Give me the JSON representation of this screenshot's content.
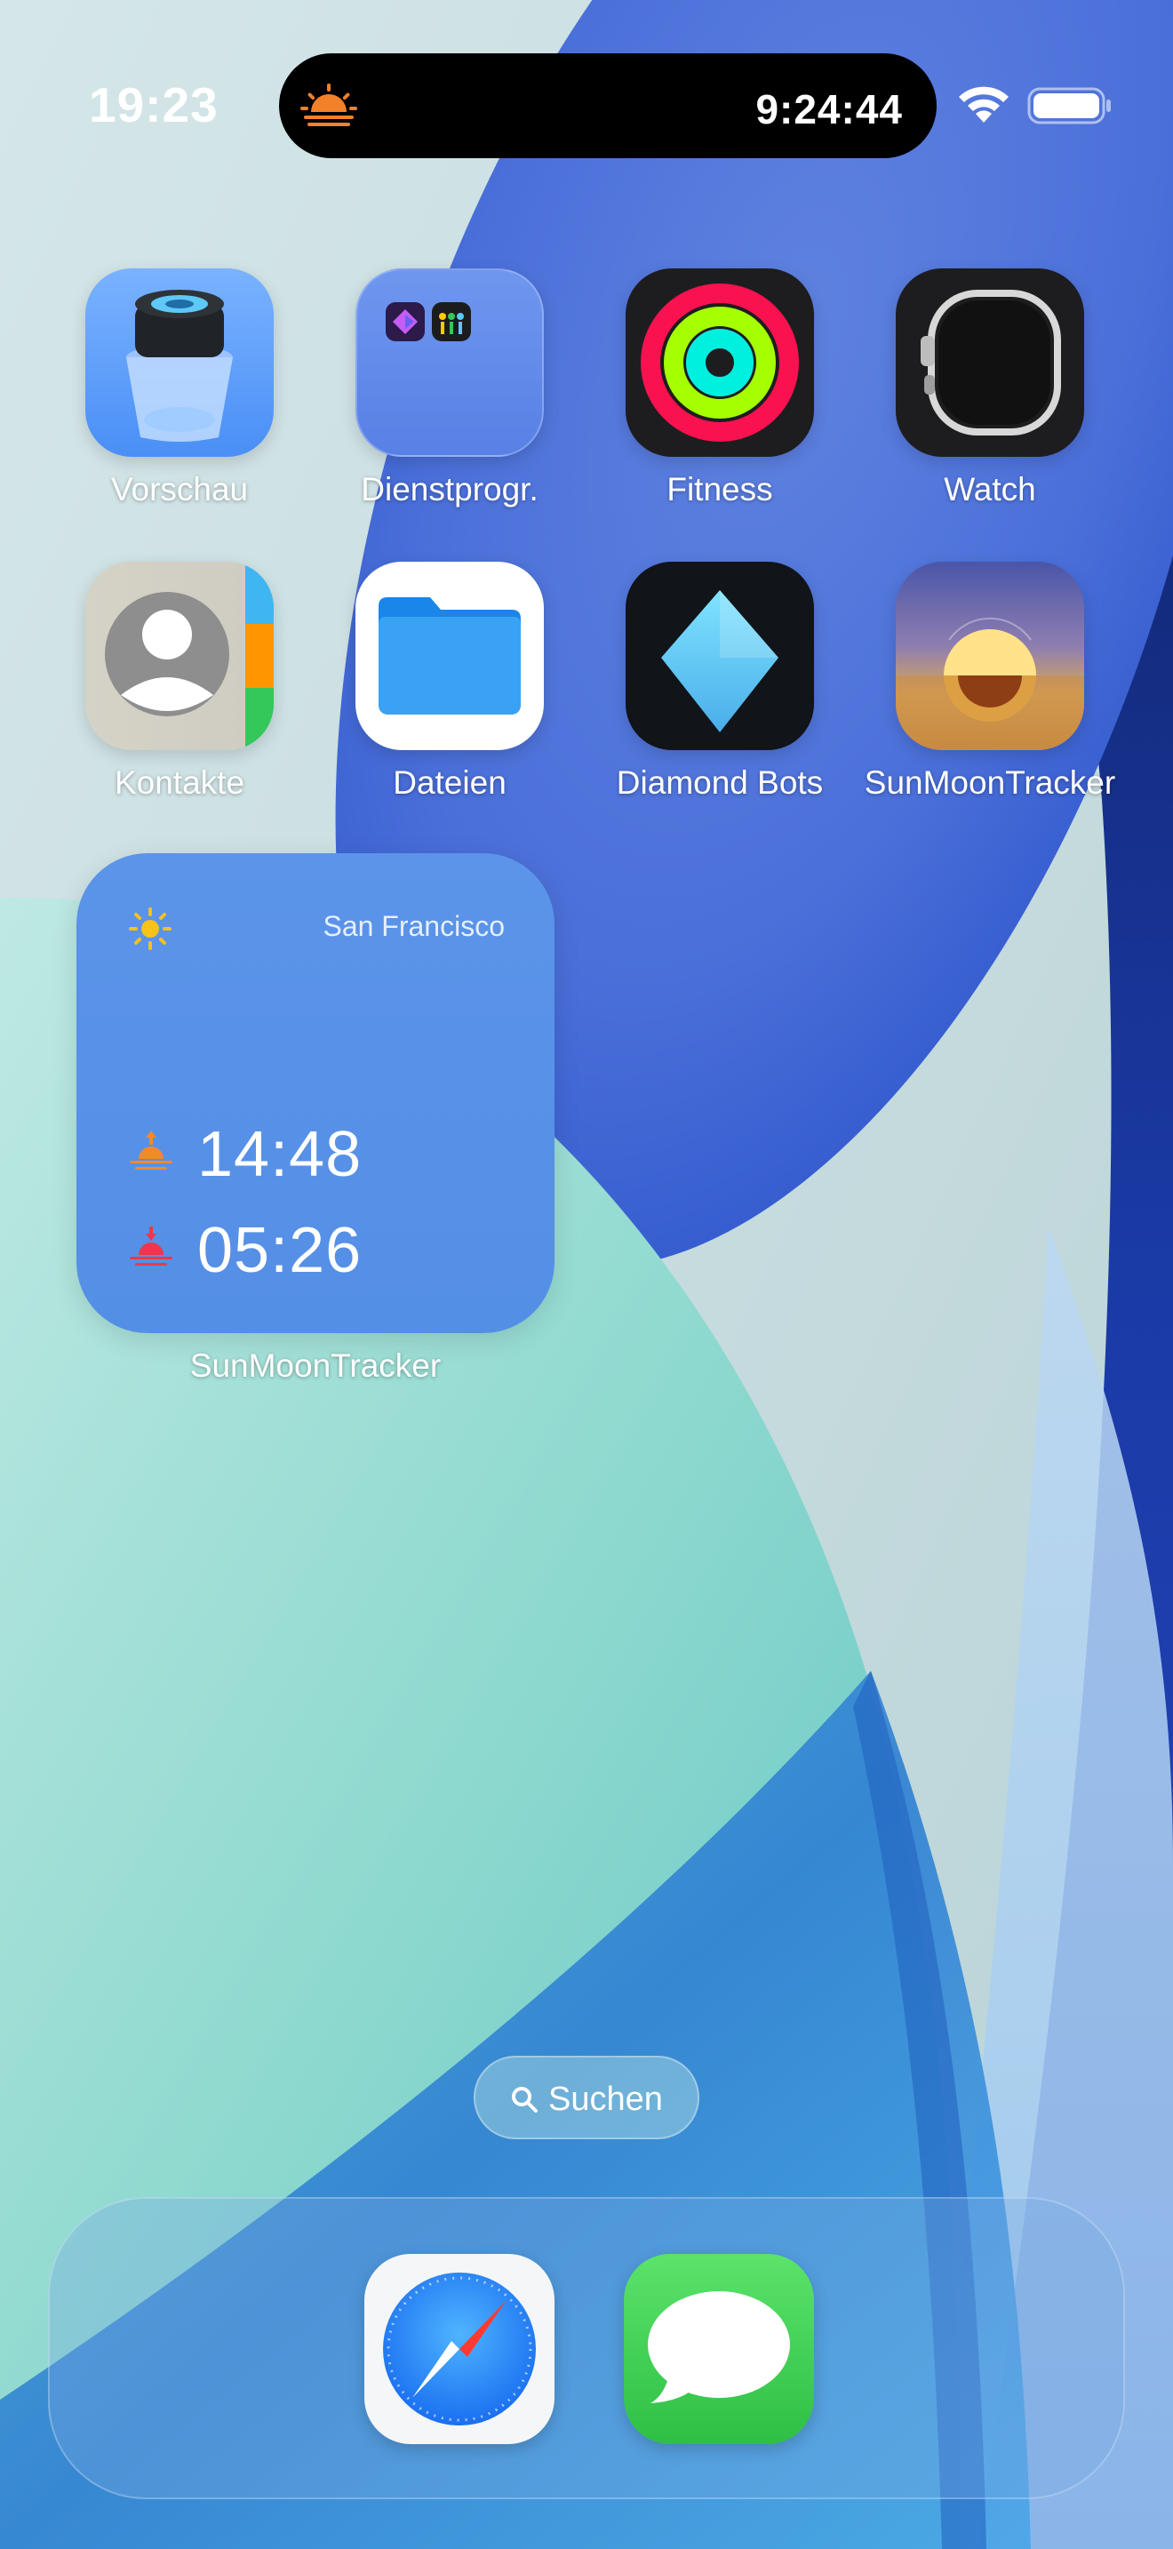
{
  "status_bar": {
    "time": "19:23",
    "live_activity_time": "9:24:44",
    "live_activity_icon": "sunrise-icon",
    "wifi_icon": "wifi-icon",
    "battery_icon": "battery-icon"
  },
  "apps": [
    {
      "label": "Vorschau",
      "icon": "preview-icon"
    },
    {
      "label": "Dienstprogr.",
      "icon": "folder-icon"
    },
    {
      "label": "Fitness",
      "icon": "activity-rings-icon"
    },
    {
      "label": "Watch",
      "icon": "watch-icon"
    },
    {
      "label": "Kontakte",
      "icon": "contacts-icon"
    },
    {
      "label": "Dateien",
      "icon": "files-icon"
    },
    {
      "label": "Diamond Bots",
      "icon": "diamond-icon"
    },
    {
      "label": "SunMoonTracker",
      "icon": "sunset-icon"
    }
  ],
  "widget": {
    "city": "San Francisco",
    "sunrise_time": "14:48",
    "sunset_time": "05:26",
    "label": "SunMoonTracker",
    "accent_color": "#5b94e9"
  },
  "search": {
    "label": "Suchen"
  },
  "dock": {
    "apps": [
      {
        "icon": "safari-icon"
      },
      {
        "icon": "messages-icon"
      }
    ]
  }
}
